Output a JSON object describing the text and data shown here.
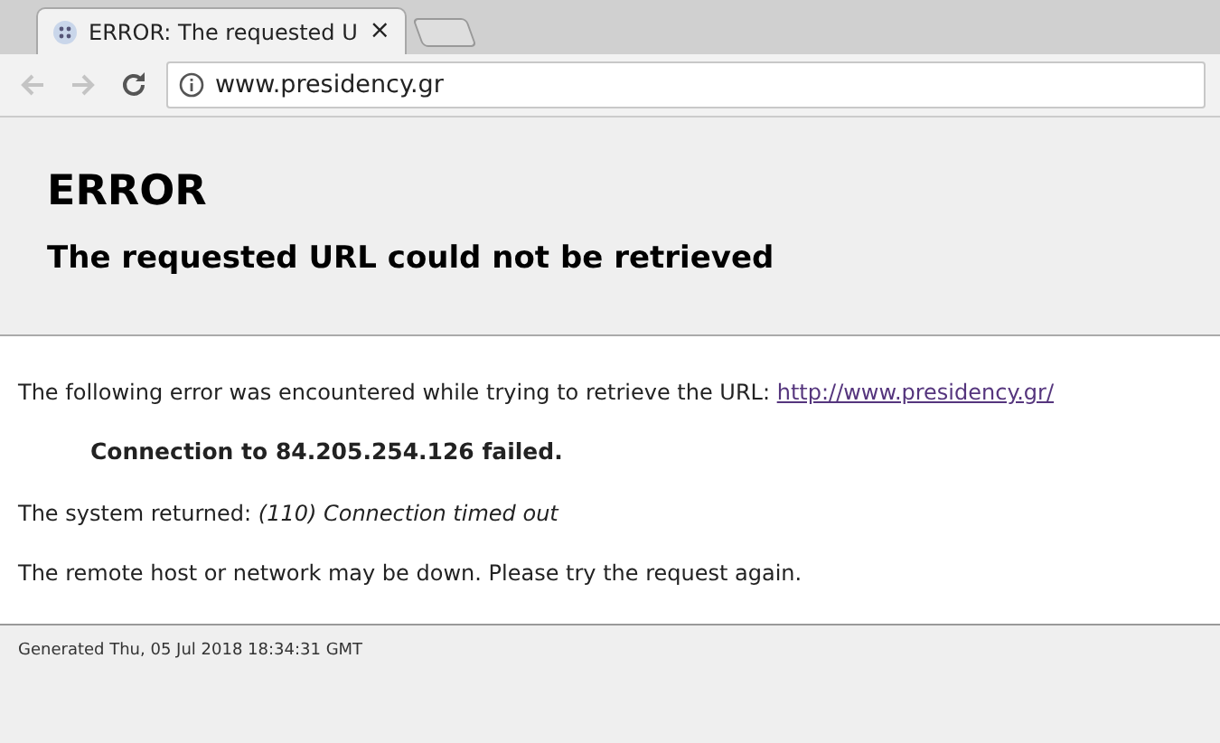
{
  "tab": {
    "title": "ERROR: The requested U",
    "close": "×"
  },
  "toolbar": {
    "back_disabled": true,
    "forward_disabled": true,
    "url": "www.presidency.gr"
  },
  "header": {
    "title": "ERROR",
    "subtitle": "The requested URL could not be retrieved"
  },
  "body": {
    "intro": "The following error was encountered while trying to retrieve the URL: ",
    "link": "http://www.presidency.gr/",
    "error": "Connection to 84.205.254.126 failed.",
    "system": "The system returned: *(110) Connection timed out*",
    "advice": "The remote host or network may be down. Please try the request again."
  },
  "footer": {
    "generated": "Generated Thu, 05 Jul 2018 18:34:31 GMT"
  }
}
